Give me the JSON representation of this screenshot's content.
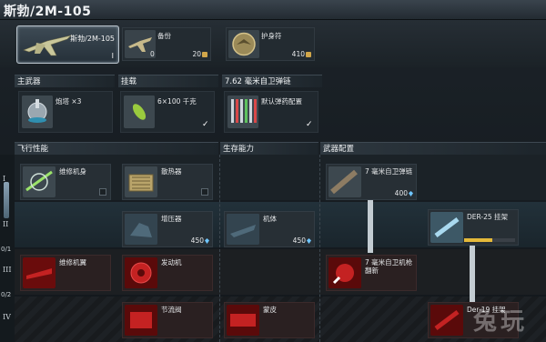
{
  "window": {
    "title": "斯勃/2M-105"
  },
  "vehicle": {
    "name": "斯勃/2M-105",
    "rank": "I"
  },
  "top_slots": [
    {
      "label": "备份",
      "left_count": "0",
      "right_count": "20"
    },
    {
      "label": "护身符",
      "left_count": "",
      "right_count": "410"
    }
  ],
  "sections": {
    "primary_weapon": "主武器",
    "mount": "挂载",
    "belt": "7.62 毫米自卫弹链",
    "flight": "飞行性能",
    "survival": "生存能力",
    "weapons_config": "武器配置"
  },
  "weapon_slots": [
    {
      "label": "炮塔 ×3"
    },
    {
      "label": "6×100 千克"
    },
    {
      "label": "默认弹药配置"
    }
  ],
  "tiers": {
    "t1": "I",
    "t2": "II",
    "t3": "III",
    "t4": "IV",
    "f1": "0/1",
    "f2": "0/2"
  },
  "modules": {
    "repair_fuselage": {
      "label": "维修机身"
    },
    "radiator": {
      "label": "散热器"
    },
    "belt7": {
      "label": "7 毫米自卫弹链",
      "cost": "400"
    },
    "compressor": {
      "label": "增压器",
      "cost": "450"
    },
    "airframe": {
      "label": "机体",
      "cost": "450"
    },
    "der25": {
      "label": "DER-25 挂架",
      "progress": 0.55
    },
    "repair_wings": {
      "label": "维修机翼"
    },
    "engine": {
      "label": "发动机"
    },
    "turret_mg": {
      "label": "7 毫米自卫机枪翻新"
    },
    "throttle": {
      "label": "节流阀"
    },
    "skin": {
      "label": "蒙皮"
    },
    "der19": {
      "label": "Der-19 挂架"
    }
  },
  "watermark": "兔玩",
  "colors": {
    "accent_gold": "#e4b93a",
    "gem": "#6fc6ff",
    "red_module": "#e2302f"
  }
}
